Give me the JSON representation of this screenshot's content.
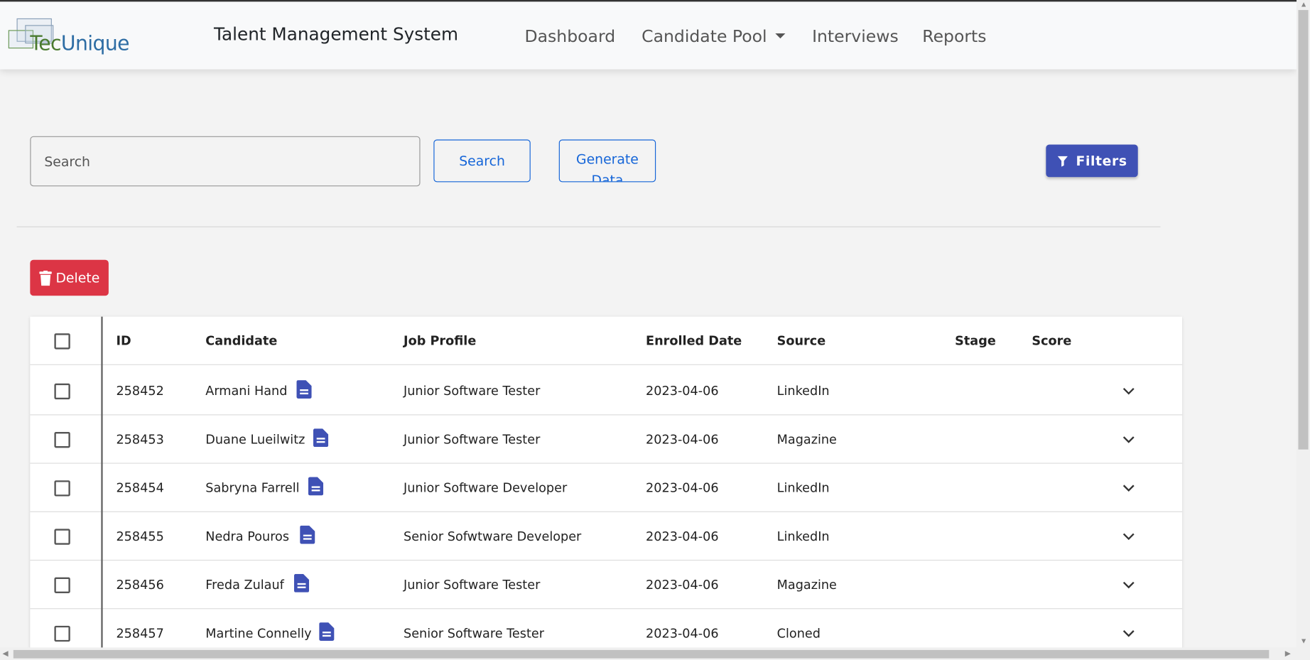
{
  "brand": {
    "logo_text_a": "Tec",
    "logo_text_b": "Unique",
    "title": "Talent Management System"
  },
  "nav": {
    "items": [
      {
        "label": "Dashboard"
      },
      {
        "label": "Candidate Pool"
      },
      {
        "label": "Interviews"
      },
      {
        "label": "Reports"
      }
    ]
  },
  "search": {
    "placeholder": "Search",
    "value": "",
    "button_label": "Search"
  },
  "toolbar": {
    "generate_label": "Generate Data",
    "filters_label": "Filters",
    "delete_label": "Delete"
  },
  "icons": {
    "filter": "filter-icon",
    "trash": "trash-icon",
    "resume": "document-icon",
    "expand": "chevron-down-icon"
  },
  "colors": {
    "primary": "#3f51b5",
    "danger": "#dc3545",
    "link": "#1565d8"
  },
  "table": {
    "headers": {
      "id": "ID",
      "candidate": "Candidate",
      "job": "Job Profile",
      "date": "Enrolled Date",
      "source": "Source",
      "stage": "Stage",
      "score": "Score"
    },
    "rows": [
      {
        "id": "258452",
        "candidate": "Armani Hand",
        "job": "Junior Software Tester",
        "date": "2023-04-06",
        "source": "LinkedIn",
        "stage": "",
        "score": ""
      },
      {
        "id": "258453",
        "candidate": "Duane Lueilwitz",
        "job": "Junior Software Tester",
        "date": "2023-04-06",
        "source": "Magazine",
        "stage": "",
        "score": ""
      },
      {
        "id": "258454",
        "candidate": "Sabryna Farrell",
        "job": "Junior Software Developer",
        "date": "2023-04-06",
        "source": "LinkedIn",
        "stage": "",
        "score": ""
      },
      {
        "id": "258455",
        "candidate": "Nedra Pouros",
        "job": "Senior Sofwtware Developer",
        "date": "2023-04-06",
        "source": "LinkedIn",
        "stage": "",
        "score": ""
      },
      {
        "id": "258456",
        "candidate": "Freda Zulauf",
        "job": "Junior Software Tester",
        "date": "2023-04-06",
        "source": "Magazine",
        "stage": "",
        "score": ""
      },
      {
        "id": "258457",
        "candidate": "Martine Connelly",
        "job": "Senior Software Tester",
        "date": "2023-04-06",
        "source": "Cloned",
        "stage": "",
        "score": ""
      }
    ]
  }
}
